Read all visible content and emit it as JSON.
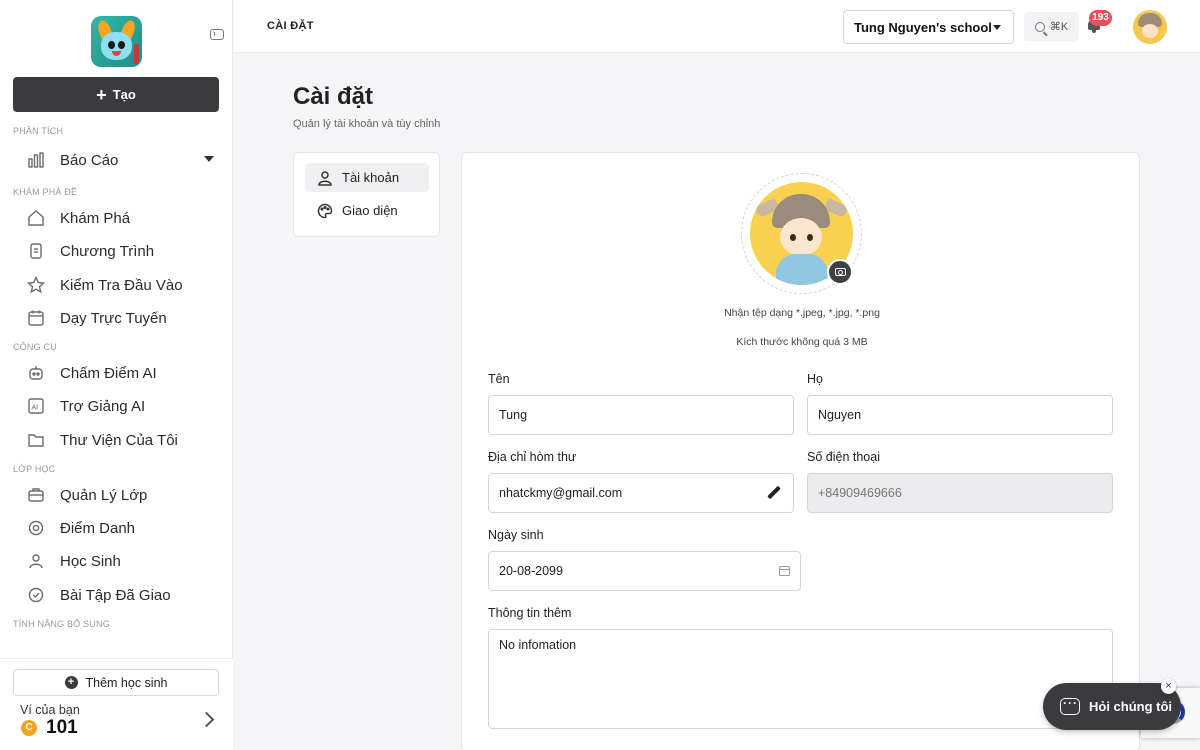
{
  "sidebar": {
    "create_label": "Tạo",
    "sections": {
      "analytics": "PHÂN TÍCH",
      "explore": "KHÁM PHÁ ĐỀ",
      "tools": "CÔNG CỤ",
      "classes": "LỚP HỌC",
      "extras": "TÍNH NĂNG BỔ SUNG"
    },
    "items": {
      "reports": "Báo Cáo",
      "explore": "Khám Phá",
      "programs": "Chương Trình",
      "entrance_test": "Kiểm Tra Đầu Vào",
      "online_teaching": "Dạy Trực Tuyến",
      "ai_grading": "Chấm Điểm AI",
      "ai_assistant": "Trợ Giảng AI",
      "my_library": "Thư Viện Của Tôi",
      "class_management": "Quản Lý Lớp",
      "attendance": "Điểm Danh",
      "students": "Học Sinh",
      "assigned_homework": "Bài Tập Đã Giao"
    },
    "add_student_label": "Thêm học sinh",
    "wallet": {
      "label": "Ví của bạn",
      "coin_symbol": "C",
      "amount": "101"
    }
  },
  "header": {
    "breadcrumb": "CÀI ĐẶT",
    "school": "Tung Nguyen's school",
    "search_shortcut": "⌘K",
    "notification_count": "193"
  },
  "page": {
    "title": "Cài đặt",
    "subtitle": "Quản lý tài khoản và tùy chỉnh"
  },
  "tabs": {
    "account": "Tài khoản",
    "appearance": "Giao diện"
  },
  "profile": {
    "upload_hint": "Nhận tệp dạng *.jpeg, *.jpg, *.png",
    "size_hint": "Kích thước không quá 3 MB",
    "first_name_label": "Tên",
    "first_name_value": "Tung",
    "last_name_label": "Họ",
    "last_name_value": "Nguyen",
    "email_label": "Địa chỉ hòm thư",
    "email_value": "nhatckmy@gmail.com",
    "phone_label": "Số điện thoại",
    "phone_placeholder": "+84909469666",
    "dob_label": "Ngày sinh",
    "dob_value": "20-08-2099",
    "about_label": "Thông tin thêm",
    "about_value": "No infomation"
  },
  "chat": {
    "label": "Hỏi chúng tôi",
    "close": "×"
  },
  "colors": {
    "primary_dark": "#3b3b3f",
    "badge": "#e9505b",
    "coin": "#f3a51d"
  }
}
